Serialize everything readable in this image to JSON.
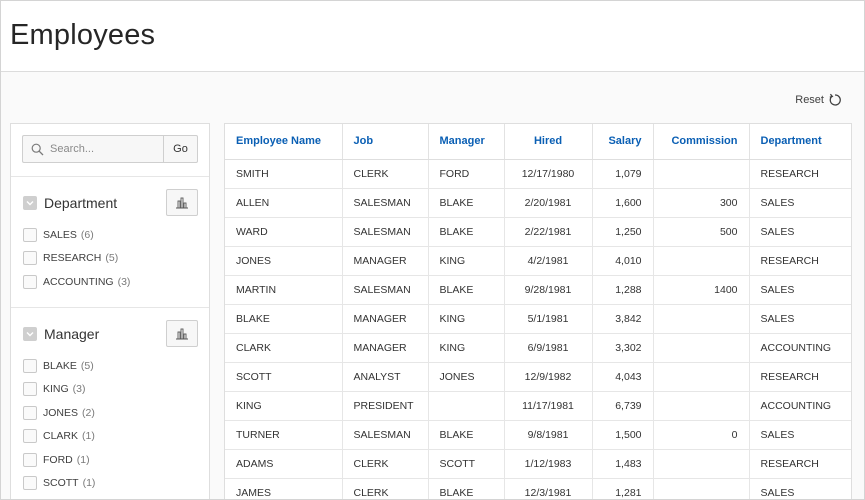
{
  "page": {
    "title": "Employees",
    "reset_label": "Reset"
  },
  "colors": {
    "link_blue": "#0a5fb4",
    "header_text": "#262626"
  },
  "search": {
    "placeholder": "Search...",
    "go_label": "Go",
    "icon": "search-icon"
  },
  "facets": [
    {
      "title": "Department",
      "items": [
        {
          "label": "SALES",
          "count": "(6)"
        },
        {
          "label": "RESEARCH",
          "count": "(5)"
        },
        {
          "label": "ACCOUNTING",
          "count": "(3)"
        }
      ]
    },
    {
      "title": "Manager",
      "items": [
        {
          "label": "BLAKE",
          "count": "(5)"
        },
        {
          "label": "KING",
          "count": "(3)"
        },
        {
          "label": "JONES",
          "count": "(2)"
        },
        {
          "label": "CLARK",
          "count": "(1)"
        },
        {
          "label": "FORD",
          "count": "(1)"
        },
        {
          "label": "SCOTT",
          "count": "(1)"
        }
      ]
    }
  ],
  "table": {
    "columns": [
      "Employee Name",
      "Job",
      "Manager",
      "Hired",
      "Salary",
      "Commission",
      "Department"
    ],
    "rows": [
      [
        "SMITH",
        "CLERK",
        "FORD",
        "12/17/1980",
        "1,079",
        "",
        "RESEARCH"
      ],
      [
        "ALLEN",
        "SALESMAN",
        "BLAKE",
        "2/20/1981",
        "1,600",
        "300",
        "SALES"
      ],
      [
        "WARD",
        "SALESMAN",
        "BLAKE",
        "2/22/1981",
        "1,250",
        "500",
        "SALES"
      ],
      [
        "JONES",
        "MANAGER",
        "KING",
        "4/2/1981",
        "4,010",
        "",
        "RESEARCH"
      ],
      [
        "MARTIN",
        "SALESMAN",
        "BLAKE",
        "9/28/1981",
        "1,288",
        "1400",
        "SALES"
      ],
      [
        "BLAKE",
        "MANAGER",
        "KING",
        "5/1/1981",
        "3,842",
        "",
        "SALES"
      ],
      [
        "CLARK",
        "MANAGER",
        "KING",
        "6/9/1981",
        "3,302",
        "",
        "ACCOUNTING"
      ],
      [
        "SCOTT",
        "ANALYST",
        "JONES",
        "12/9/1982",
        "4,043",
        "",
        "RESEARCH"
      ],
      [
        "KING",
        "PRESIDENT",
        "",
        "11/17/1981",
        "6,739",
        "",
        "ACCOUNTING"
      ],
      [
        "TURNER",
        "SALESMAN",
        "BLAKE",
        "9/8/1981",
        "1,500",
        "0",
        "SALES"
      ],
      [
        "ADAMS",
        "CLERK",
        "SCOTT",
        "1/12/1983",
        "1,483",
        "",
        "RESEARCH"
      ],
      [
        "JAMES",
        "CLERK",
        "BLAKE",
        "12/3/1981",
        "1,281",
        "",
        "SALES"
      ]
    ]
  }
}
